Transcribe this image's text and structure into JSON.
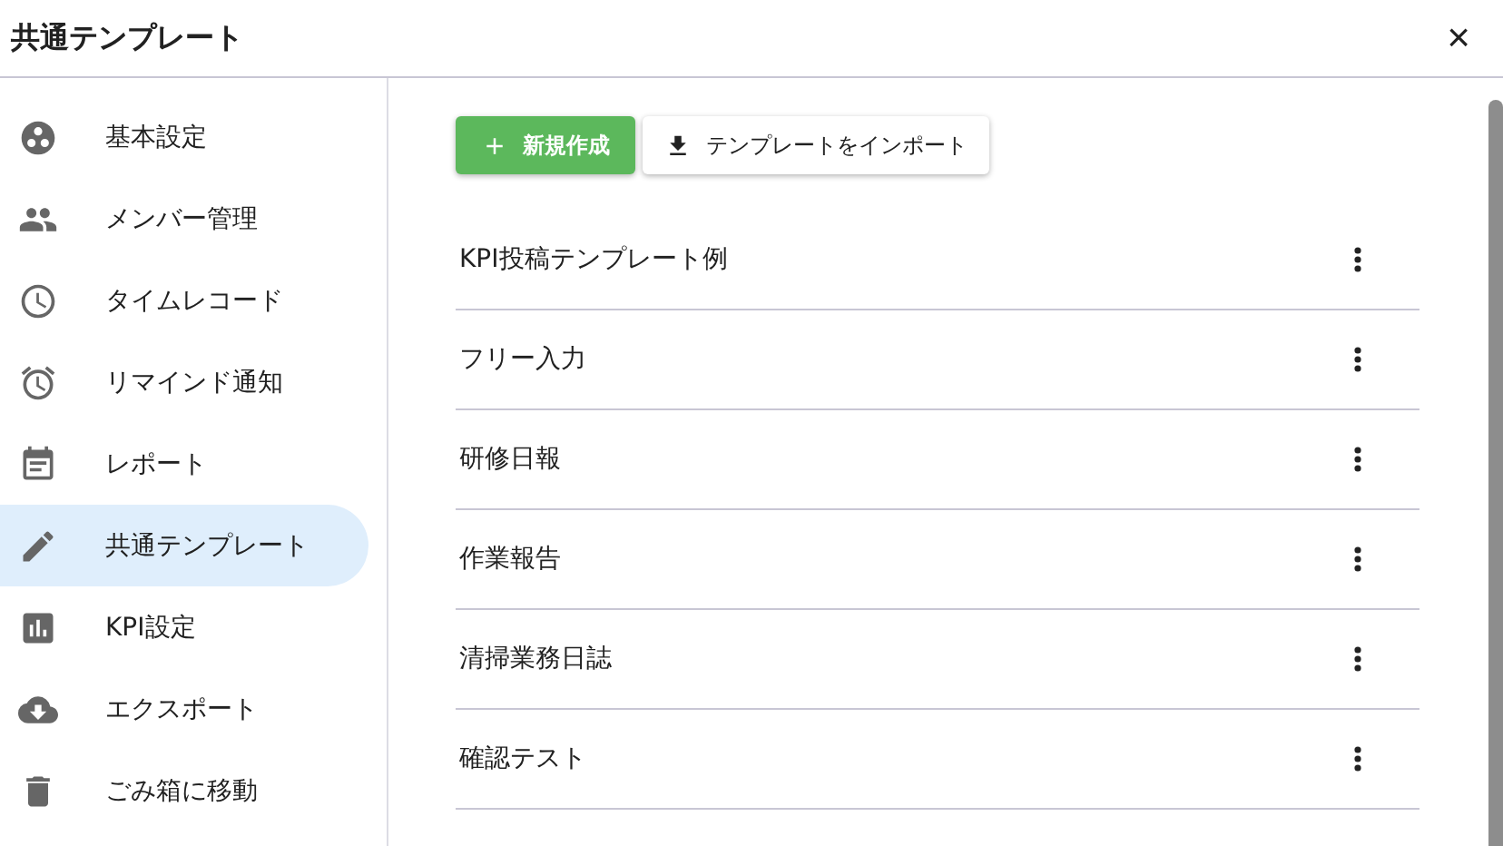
{
  "window": {
    "title": "共通テンプレート",
    "close": "×"
  },
  "sidebar": {
    "items": [
      {
        "label": "基本設定",
        "selected": false
      },
      {
        "label": "メンバー管理",
        "selected": false
      },
      {
        "label": "タイムレコード",
        "selected": false
      },
      {
        "label": "リマインド通知",
        "selected": false
      },
      {
        "label": "レポート",
        "selected": false
      },
      {
        "label": "共通テンプレート",
        "selected": true
      },
      {
        "label": "KPI設定",
        "selected": false
      },
      {
        "label": "エクスポート",
        "selected": false
      },
      {
        "label": "ごみ箱に移動",
        "selected": false
      }
    ]
  },
  "toolbar": {
    "buttons": [
      {
        "label": "新規作成",
        "kind": "primary"
      },
      {
        "label": "テンプレートをインポート",
        "kind": "secondary"
      }
    ]
  },
  "templates": [
    {
      "name": "KPI投稿テンプレート例"
    },
    {
      "name": "フリー入力"
    },
    {
      "name": "研修日報"
    },
    {
      "name": "作業報告"
    },
    {
      "name": "清掃業務日誌"
    },
    {
      "name": "確認テスト"
    }
  ]
}
